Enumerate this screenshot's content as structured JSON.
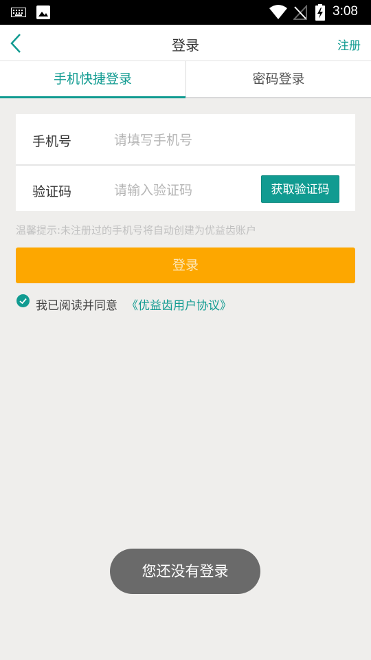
{
  "status_bar": {
    "time": "3:08",
    "icons": [
      "keyboard-icon",
      "image-icon",
      "wifi-icon",
      "signal-off-icon",
      "battery-charging-icon"
    ]
  },
  "header": {
    "title": "登录",
    "register_label": "注册",
    "back_icon": "chevron-left-icon"
  },
  "tabs": [
    {
      "label": "手机快捷登录",
      "active": true
    },
    {
      "label": "密码登录",
      "active": false
    }
  ],
  "form": {
    "phone": {
      "label": "手机号",
      "placeholder": "请填写手机号",
      "value": ""
    },
    "code": {
      "label": "验证码",
      "placeholder": "请输入验证码",
      "value": "",
      "button_label": "获取验证码"
    }
  },
  "tip": "温馨提示:未注册过的手机号将自动创建为优益齿账户",
  "login_button": "登录",
  "agreement": {
    "checked": true,
    "text": "我已阅读并同意",
    "link": "《优益齿用户协议》"
  },
  "toast": "您还没有登录",
  "colors": {
    "accent": "#119b91",
    "login_button": "#fda700",
    "background": "#efeeec"
  }
}
